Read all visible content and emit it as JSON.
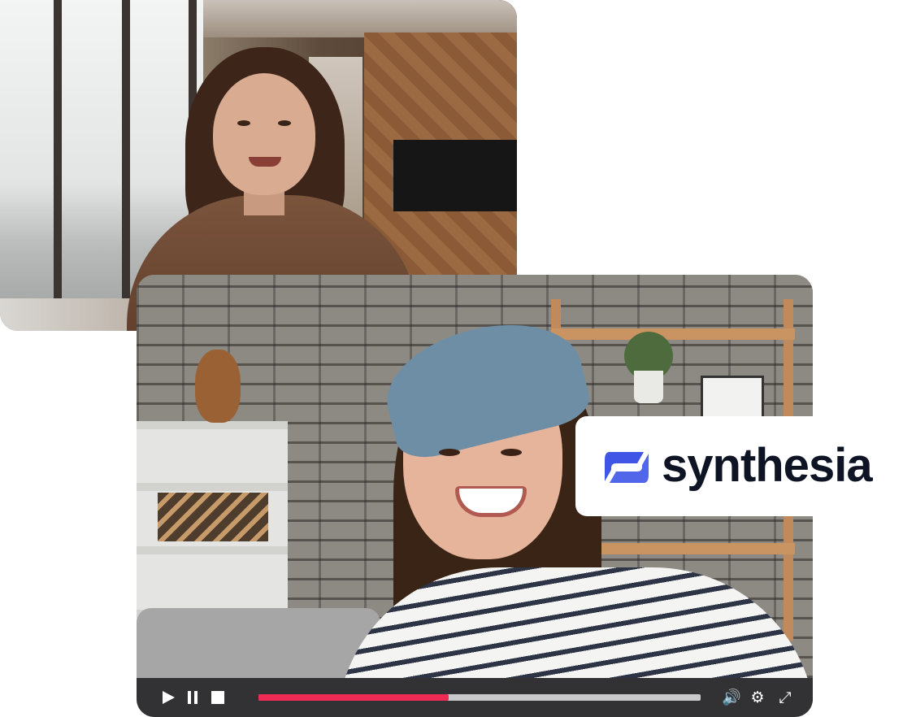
{
  "brand": {
    "name": "synthesia",
    "mark_color": "#3e55e6",
    "text_color": "#0f1424"
  },
  "player": {
    "progress_percent": 43,
    "progress_color": "#ee2a55",
    "controls": {
      "play_icon": "play-icon",
      "pause_icon": "pause-icon",
      "stop_icon": "stop-icon",
      "volume_icon": "volume-icon",
      "settings_icon": "gear-icon",
      "fullscreen_icon": "fullscreen-icon"
    }
  },
  "images": {
    "top": "presenter-woman-office-photo",
    "bottom": "smiling-girl-selfie-video"
  }
}
